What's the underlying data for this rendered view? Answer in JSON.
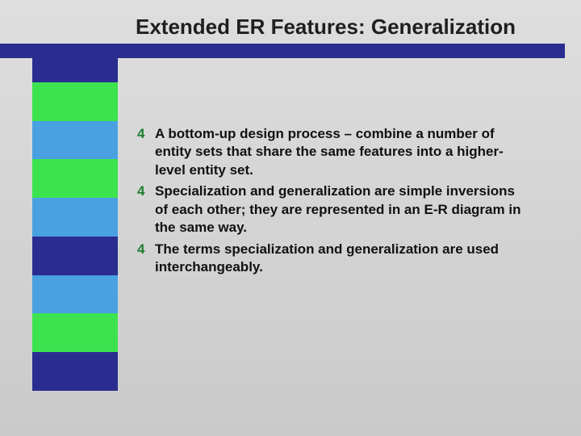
{
  "title": "Extended ER Features: Generalization",
  "bullets": [
    {
      "lead": "A bottom-up design process",
      "rest": " – combine a number of entity sets that share the same features into a higher-level entity set."
    },
    {
      "lead": "",
      "rest": "Specialization and generalization are simple inversions of each other; they are represented in an E-R diagram in the same way."
    },
    {
      "lead": "",
      "rest": "The terms specialization and generalization are used interchangeably."
    }
  ],
  "marker": "4"
}
